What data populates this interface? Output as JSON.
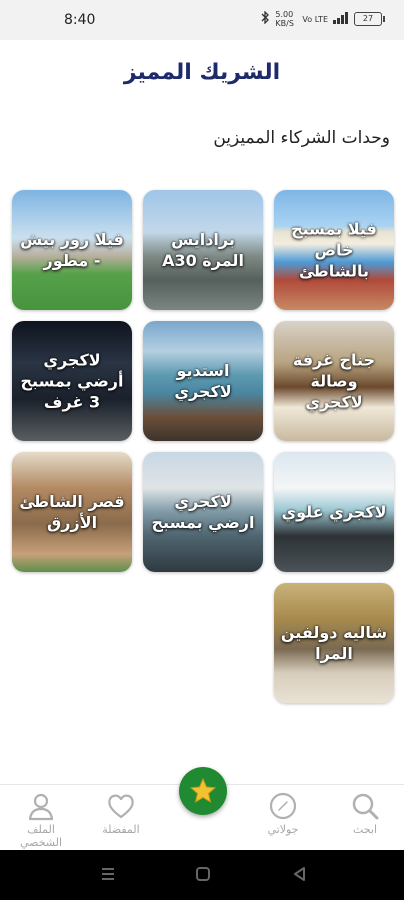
{
  "status_bar": {
    "time": "8:40",
    "network": "5.00 KB/S",
    "sim": "Vo LTE",
    "battery": "27"
  },
  "header": {
    "title": "الشريك المميز"
  },
  "section": {
    "title": "وحدات الشركاء المميزين"
  },
  "units": [
    {
      "label": "فيلا بمسبح خاص بالشاطئ"
    },
    {
      "label": "برادايس المرة A30"
    },
    {
      "label": "فيلا رور بيش - مطور"
    },
    {
      "label": "جناح غرفة وصالة لاكجري"
    },
    {
      "label": "استديو لاكجري"
    },
    {
      "label": "لاكجري أرضي بمسبح 3 غرف"
    },
    {
      "label": "لاكجري علوي"
    },
    {
      "label": "لاكجري ارضي بمسبح"
    },
    {
      "label": "قصر الشاطئ الأزرق"
    },
    {
      "label": "شاليه دولفين المرا"
    }
  ],
  "bottom_nav": {
    "search": "ابحث",
    "explore": "جولاتي",
    "favorites": "المفضلة",
    "profile": "الملف الشخصي"
  },
  "colors": {
    "title": "#1d2a6b",
    "fab": "#1f8a32",
    "nav_inactive": "#a7a7a7"
  }
}
